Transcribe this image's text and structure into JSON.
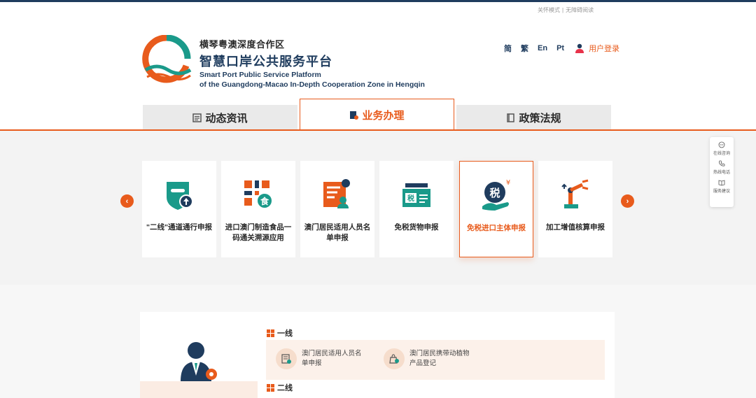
{
  "accessibility": {
    "care_mode": "关怀模式",
    "separator": "|",
    "barrier_free": "无障碍阅读"
  },
  "header": {
    "title_cn_small": "横琴粤澳深度合作区",
    "title_cn_big": "智慧口岸公共服务平台",
    "title_en_line1": "Smart Port Public Service Platform",
    "title_en_line2": "of the Guangdong-Macao In-Depth Cooperation Zone in Hengqin"
  },
  "languages": [
    "简",
    "繁",
    "En",
    "Pt"
  ],
  "login_label": "用户登录",
  "tabs": [
    {
      "label": "动态资讯"
    },
    {
      "label": "业务办理"
    },
    {
      "label": "政策法规"
    }
  ],
  "carousel": {
    "prev_glyph": "‹",
    "next_glyph": "›",
    "cards": [
      {
        "label": "\"二线\"通道通行申报",
        "icon": "shield-upload-icon"
      },
      {
        "label": "进口澳门制造食品一码通关溯源应用",
        "icon": "qr-food-icon"
      },
      {
        "label": "澳门居民适用人员名单申报",
        "icon": "person-list-icon"
      },
      {
        "label": "免税货物申报",
        "icon": "tax-goods-icon"
      },
      {
        "label": "免税进口主体申报",
        "icon": "tax-coin-icon"
      },
      {
        "label": "加工增值核算申报",
        "icon": "robot-arm-icon"
      }
    ],
    "active_index": 4
  },
  "float_panel": [
    {
      "label": "在线咨询",
      "icon": "chat-icon"
    },
    {
      "label": "热线电话",
      "icon": "phone-icon"
    },
    {
      "label": "服务建议",
      "icon": "book-icon"
    }
  ],
  "lower": {
    "section1_title": "一线",
    "section2_title": "二线",
    "services": [
      {
        "label": "澳门居民适用人员名单申报",
        "icon": "list-doc-icon"
      },
      {
        "label": "澳门居民携带动植物产品登记",
        "icon": "plant-bag-icon"
      }
    ]
  },
  "colors": {
    "accent": "#e85b1c",
    "navy": "#1f3c5e",
    "teal": "#1a9a8a"
  }
}
